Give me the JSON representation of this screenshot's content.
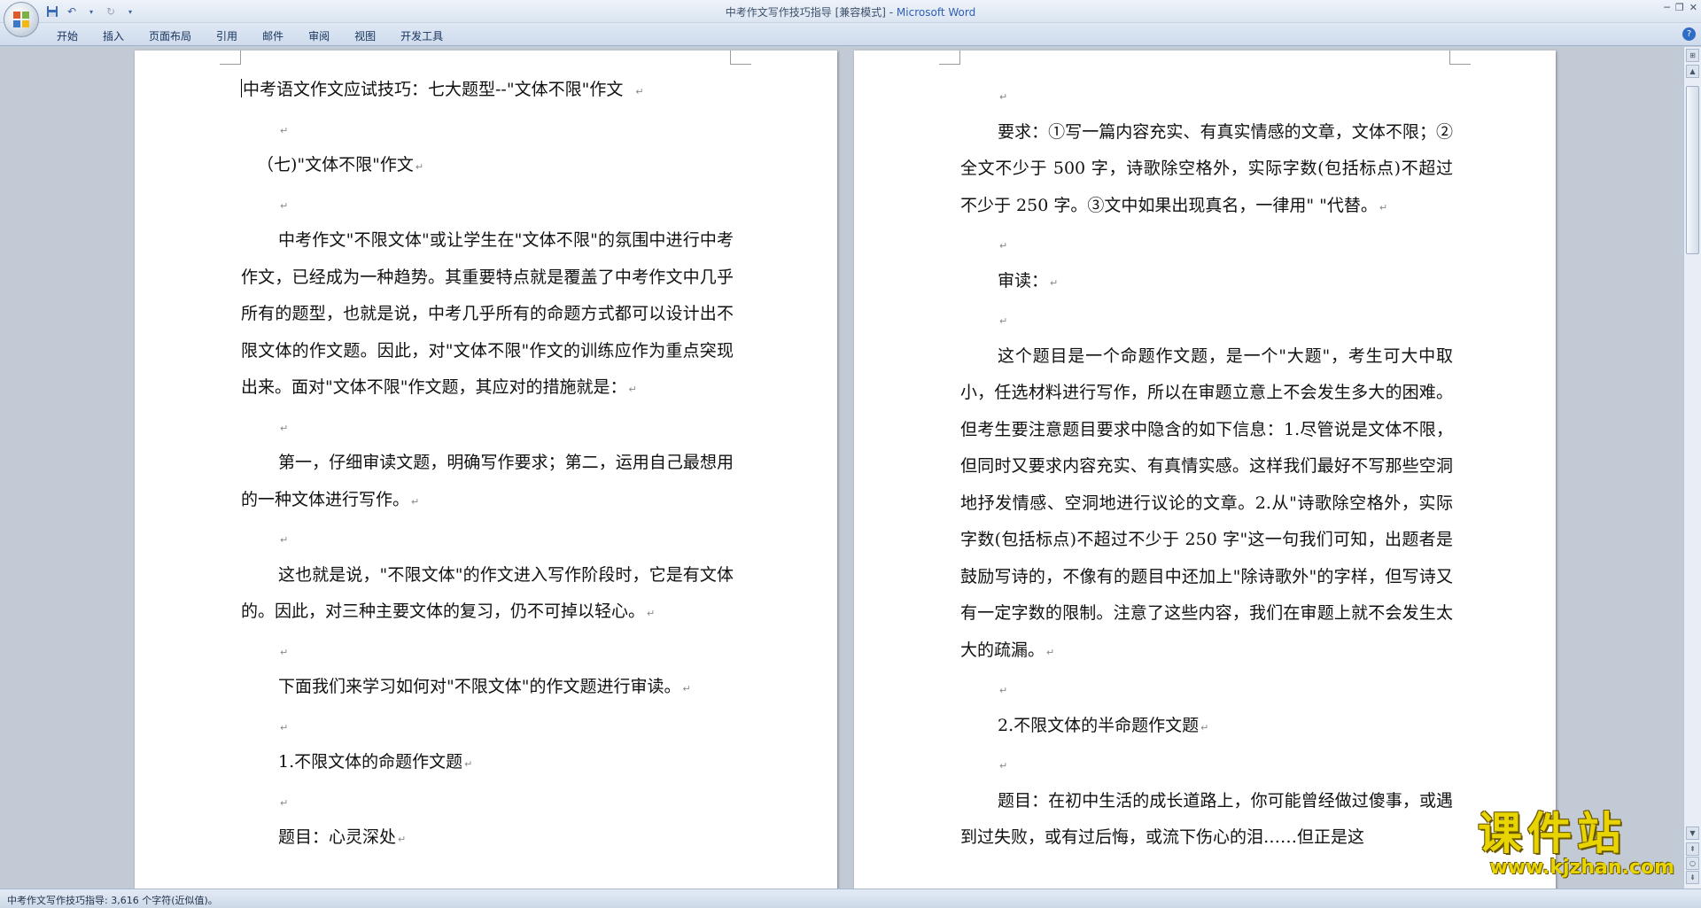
{
  "window": {
    "title": "中考作文写作技巧指导 [兼容模式] - ",
    "app_name": "Microsoft Word"
  },
  "ribbon": {
    "tabs": [
      "开始",
      "插入",
      "页面布局",
      "引用",
      "邮件",
      "审阅",
      "视图",
      "开发工具"
    ]
  },
  "icons": {
    "office_button": "office-logo-icon",
    "save": "save-icon",
    "undo": "undo-icon",
    "redo": "redo-icon",
    "customize": "dropdown-icon",
    "help": "help-icon"
  },
  "page_left": {
    "paragraphs": [
      {
        "text": "中考语文作文应试技巧：七大题型--\"文体不限\"作文  ",
        "style": "title"
      },
      {
        "text": "",
        "style": "empty"
      },
      {
        "text": "（七)\"文体不限\"作文",
        "style": "plain"
      },
      {
        "text": "",
        "style": "empty"
      },
      {
        "text": "中考作文\"不限文体\"或让学生在\"文体不限\"的氛围中进行中考作文，已经成为一种趋势。其重要特点就是覆盖了中考作文中几乎所有的题型，也就是说，中考几乎所有的命题方式都可以设计出不限文体的作文题。因此，对\"文体不限\"作文的训练应作为重点突现出来。面对\"文体不限\"作文题，其应对的措施就是：",
        "style": "indent"
      },
      {
        "text": "",
        "style": "empty"
      },
      {
        "text": "第一，仔细审读文题，明确写作要求；第二，运用自己最想用的一种文体进行写作。",
        "style": "indent"
      },
      {
        "text": "",
        "style": "empty"
      },
      {
        "text": "这也就是说，\"不限文体\"的作文进入写作阶段时，它是有文体的。因此，对三种主要文体的复习，仍不可掉以轻心。",
        "style": "indent"
      },
      {
        "text": "",
        "style": "empty"
      },
      {
        "text": "下面我们来学习如何对\"不限文体\"的作文题进行审读。",
        "style": "indent"
      },
      {
        "text": "",
        "style": "empty"
      },
      {
        "text": "1.不限文体的命题作文题",
        "style": "indent"
      },
      {
        "text": "",
        "style": "empty"
      },
      {
        "text": "题目：心灵深处",
        "style": "indent"
      }
    ]
  },
  "page_right": {
    "paragraphs": [
      {
        "text": "",
        "style": "empty"
      },
      {
        "text": "要求：①写一篇内容充实、有真实情感的文章，文体不限；②全文不少于 500 字，诗歌除空格外，实际字数(包括标点)不超过不少于 250 字。③文中如果出现真名，一律用\" \"代替。",
        "style": "indent"
      },
      {
        "text": "",
        "style": "empty"
      },
      {
        "text": "审读：",
        "style": "indent"
      },
      {
        "text": "",
        "style": "empty"
      },
      {
        "text": "这个题目是一个命题作文题，是一个\"大题\"，考生可大中取小，任选材料进行写作，所以在审题立意上不会发生多大的困难。但考生要注意题目要求中隐含的如下信息：1.尽管说是文体不限，但同时又要求内容充实、有真情实感。这样我们最好不写那些空洞地抒发情感、空洞地进行议论的文章。2.从\"诗歌除空格外，实际字数(包括标点)不超过不少于 250 字\"这一句我们可知，出题者是鼓励写诗的，不像有的题目中还加上\"除诗歌外\"的字样，但写诗又有一定字数的限制。注意了这些内容，我们在审题上就不会发生太大的疏漏。",
        "style": "indent"
      },
      {
        "text": "",
        "style": "empty"
      },
      {
        "text": "2.不限文体的半命题作文题",
        "style": "indent"
      },
      {
        "text": "",
        "style": "empty"
      },
      {
        "text": "题目：在初中生活的成长道路上，你可能曾经做过傻事，或遇到过失败，或有过后悔，或流下伤心的泪……但正是这",
        "style": "indent",
        "no_mark": true
      }
    ]
  },
  "status_bar": {
    "text": "中考作文写作技巧指导: 3,616 个字符(近似值)。"
  },
  "watermark": {
    "big": "课件站",
    "url": "www.kjzhan.com"
  },
  "colors": {
    "workspace_bg": "#c2cad6",
    "title_accent": "#2e5fb8",
    "watermark_yellow": "#e8d400"
  }
}
